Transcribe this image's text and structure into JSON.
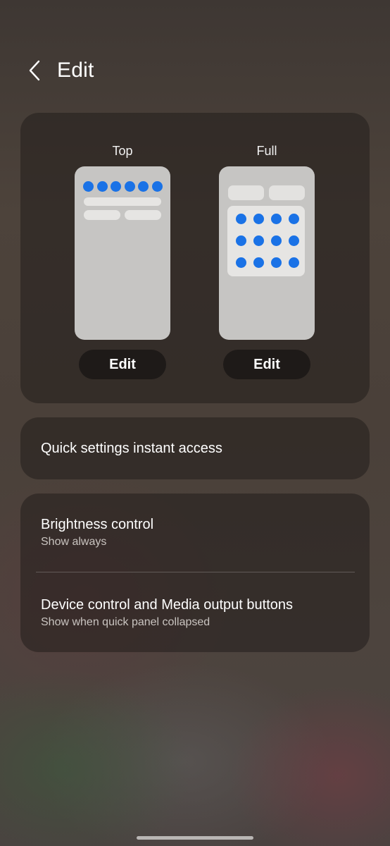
{
  "header": {
    "title": "Edit"
  },
  "layouts": [
    {
      "label": "Top",
      "edit_label": "Edit"
    },
    {
      "label": "Full",
      "edit_label": "Edit"
    }
  ],
  "instant_access": {
    "label": "Quick settings instant access"
  },
  "settings": [
    {
      "title": "Brightness control",
      "subtitle": "Show always"
    },
    {
      "title": "Device control and Media output buttons",
      "subtitle": "Show when quick panel collapsed"
    }
  ],
  "icons": {
    "back": "chevron-left-icon"
  },
  "colors": {
    "accent_dot": "#1a72e6",
    "card_bg": "#231e1c",
    "button_bg": "#1e1a18",
    "preview_bg": "#c6c5c3"
  }
}
